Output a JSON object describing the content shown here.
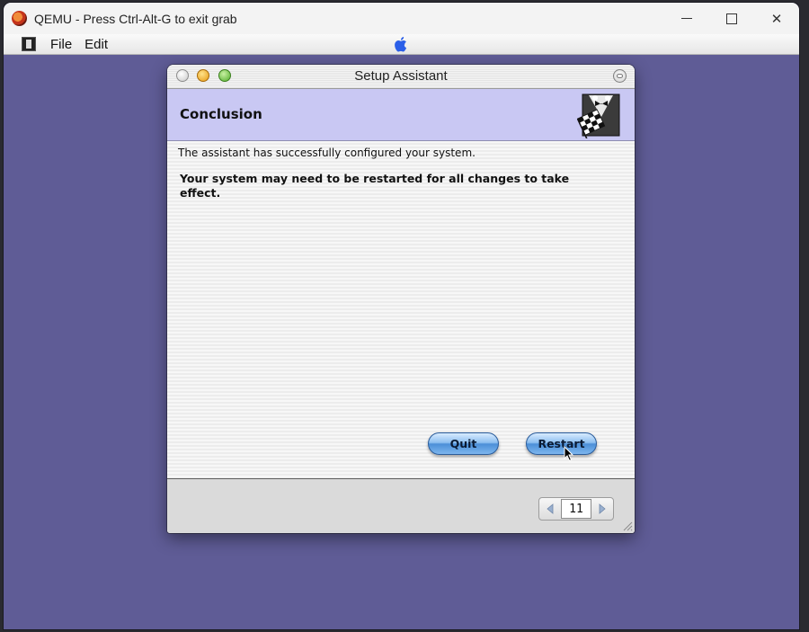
{
  "host": {
    "title": "QEMU - Press Ctrl-Alt-G to exit grab",
    "controls": {
      "minimize": "minimize-icon",
      "maximize": "maximize-icon",
      "close": "✕"
    }
  },
  "guest_menubar": {
    "items": [
      {
        "label": "File"
      },
      {
        "label": "Edit"
      }
    ]
  },
  "dialog": {
    "title": "Setup Assistant",
    "header_title": "Conclusion",
    "message": "The assistant has successfully configured your system.",
    "restart_note": "Your system may need to be restarted for all changes to take effect.",
    "buttons": {
      "quit": "Quit",
      "restart": "Restart"
    },
    "page_number": "11"
  },
  "colors": {
    "desktop": "#5f5c96",
    "header": "#c9c8f3",
    "aqua_button": "#4b8fd8"
  }
}
